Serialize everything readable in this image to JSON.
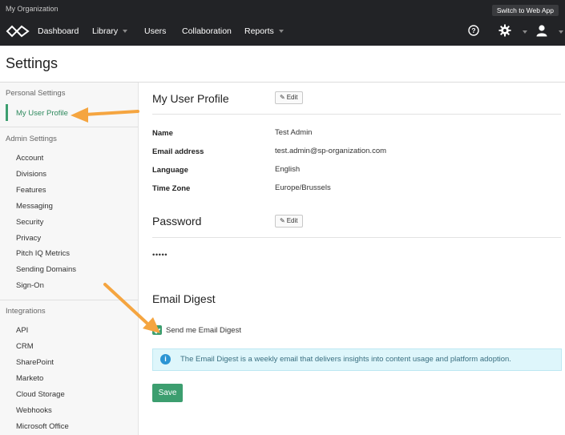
{
  "topbar": {
    "org_name": "My Organization",
    "switch_label": "Switch to Web App",
    "nav": [
      "Dashboard",
      "Library",
      "Users",
      "Collaboration",
      "Reports"
    ]
  },
  "page": {
    "title": "Settings"
  },
  "sidebar": {
    "personal_heading": "Personal Settings",
    "personal_items": [
      "My User Profile"
    ],
    "admin_heading": "Admin Settings",
    "admin_items": [
      "Account",
      "Divisions",
      "Features",
      "Messaging",
      "Security",
      "Privacy",
      "Pitch IQ Metrics",
      "Sending Domains",
      "Sign-On"
    ],
    "integrations_heading": "Integrations",
    "integration_items": [
      "API",
      "CRM",
      "SharePoint",
      "Marketo",
      "Cloud Storage",
      "Webhooks",
      "Microsoft Office"
    ]
  },
  "profile": {
    "heading": "My User Profile",
    "edit_label": "Edit",
    "fields": [
      {
        "label": "Name",
        "value": "Test Admin"
      },
      {
        "label": "Email address",
        "value": "test.admin@sp-organization.com"
      },
      {
        "label": "Language",
        "value": "English"
      },
      {
        "label": "Time Zone",
        "value": "Europe/Brussels"
      }
    ]
  },
  "password": {
    "heading": "Password",
    "edit_label": "Edit",
    "masked": "•••••"
  },
  "digest": {
    "heading": "Email Digest",
    "checkbox_label": "Send me Email Digest",
    "checked": true,
    "info_text": "The Email Digest is a weekly email that delivers insights into content usage and platform adoption.",
    "save_label": "Save"
  },
  "colors": {
    "accent": "#3c9e6f",
    "topbar": "#222326",
    "annotation_arrow": "#f5a540",
    "info_bg": "#def6fb"
  }
}
